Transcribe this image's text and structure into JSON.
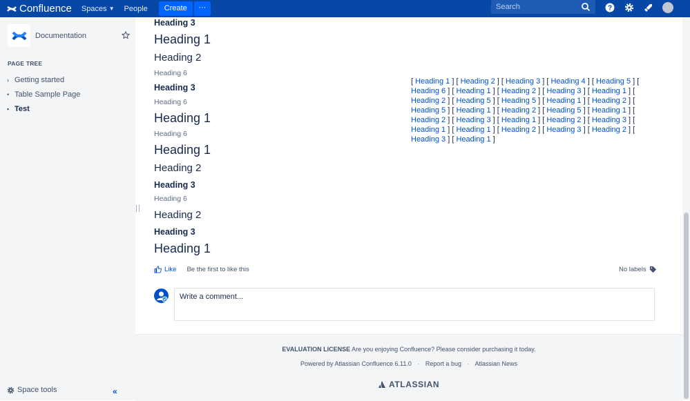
{
  "topnav": {
    "brand": "Confluence",
    "items": [
      {
        "label": "Spaces",
        "has_menu": true
      },
      {
        "label": "People",
        "has_menu": false
      }
    ],
    "create_label": "Create",
    "more_label": "···",
    "search_placeholder": "Search"
  },
  "sidebar": {
    "space_name": "Documentation",
    "page_tree_heading": "PAGE TREE",
    "tree": [
      {
        "label": "Getting started",
        "marker": "›",
        "active": false
      },
      {
        "label": "Table Sample Page",
        "marker": "•",
        "active": false
      },
      {
        "label": "Test",
        "marker": "•",
        "active": true
      }
    ],
    "space_tools_label": "Space tools",
    "collapse_label": "«"
  },
  "content": {
    "headings": [
      {
        "level": 3,
        "text": "Heading 3"
      },
      {
        "level": 1,
        "text": "Heading 1"
      },
      {
        "level": 2,
        "text": "Heading 2"
      },
      {
        "level": 6,
        "text": "Heading 6"
      },
      {
        "level": 3,
        "text": "Heading 3"
      },
      {
        "level": 6,
        "text": "Heading 6"
      },
      {
        "level": 1,
        "text": "Heading 1"
      },
      {
        "level": 6,
        "text": "Heading 6"
      },
      {
        "level": 1,
        "text": "Heading 1"
      },
      {
        "level": 2,
        "text": "Heading 2"
      },
      {
        "level": 3,
        "text": "Heading 3"
      },
      {
        "level": 6,
        "text": "Heading 6"
      },
      {
        "level": 2,
        "text": "Heading 2"
      },
      {
        "level": 3,
        "text": "Heading 3"
      },
      {
        "level": 1,
        "text": "Heading 1"
      }
    ],
    "toc_links": [
      "Heading 1",
      "Heading 2",
      "Heading 3",
      "Heading 4",
      "Heading 5",
      "Heading 6",
      "Heading 1",
      "Heading 2",
      "Heading 3",
      "Heading 1",
      "Heading 2",
      "Heading 5",
      "Heading 5",
      "Heading 1",
      "Heading 2",
      "Heading 5",
      "Heading 1",
      "Heading 2",
      "Heading 5",
      "Heading 1",
      "Heading 2",
      "Heading 3",
      "Heading 1",
      "Heading 2",
      "Heading 3",
      "Heading 1",
      "Heading 1",
      "Heading 2",
      "Heading 3",
      "Heading 2",
      "Heading 3",
      "Heading 1"
    ],
    "like_label": "Like",
    "like_text": "Be the first to like this",
    "labels_text": "No labels",
    "comment_placeholder": "Write a comment..."
  },
  "footer": {
    "license_bold": "EVALUATION LICENSE",
    "license_text": "Are you enjoying Confluence? Please consider purchasing it today.",
    "powered": "Powered by Atlassian Confluence 6.11.0",
    "report_bug": "Report a bug",
    "news": "Atlassian News",
    "logo_text": "ATLASSIAN"
  }
}
